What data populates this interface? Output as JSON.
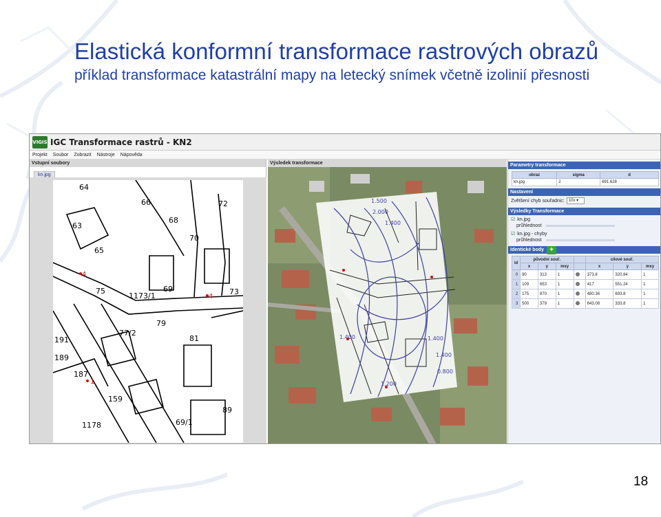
{
  "slide": {
    "title": "Elastická konformní transformace rastrových obrazů",
    "subtitle": "příklad transformace katastrální mapy na letecký snímek včetně izolinií přesnosti",
    "page_number": "18",
    "title_color": "#1f3fa8"
  },
  "app": {
    "logo": "VIGIS",
    "title": "IGC Transformace rastrů - KN2",
    "menu": [
      "Projekt",
      "Soubor",
      "Zobrazit",
      "Nástroje",
      "Nápověda"
    ]
  },
  "left_panel": {
    "header": "Vstupní soubory",
    "file_tab": "kn.jpg",
    "map_labels": [
      "64",
      "66",
      "68",
      "63",
      "70",
      "72",
      "65",
      "69",
      "1173/1",
      "73",
      "75",
      "77/2",
      "79",
      "191",
      "189",
      "81",
      "187",
      "159",
      "89",
      "1178",
      "69/1",
      "4",
      "4",
      "1",
      "1",
      "1",
      "1",
      "2",
      "3"
    ]
  },
  "mid_panel": {
    "header": "Výsledek transformace",
    "isoline_labels": [
      "1.500",
      "2.000",
      "1.400",
      "1.400",
      "1.400",
      "1.400",
      "1.200",
      "0.800"
    ]
  },
  "right_panel": {
    "params_header": "Parametry transformace",
    "params_columns": [
      "obraz",
      "sigma",
      "d"
    ],
    "params_row": [
      "kn.jpg",
      "2",
      "691.628"
    ],
    "settings_header": "Nastavení",
    "zoom_label": "Zvětšení chyb souřadnic:",
    "zoom_value": "10x",
    "results_header": "Výsledky Transformace",
    "results_items": [
      {
        "label": "kn.jpg",
        "sub": "průhlednost"
      },
      {
        "label": "kn.jpg - chyby",
        "sub": "průhlednost"
      }
    ],
    "identical_header": "Identické body",
    "identical_group_source": "původní souř.",
    "identical_group_target": "cílové souř.",
    "identical_columns": [
      "id",
      "x",
      "y",
      "mxy",
      "x",
      "y",
      "mxy"
    ],
    "identical_rows": [
      [
        "0",
        "90",
        "313",
        "1",
        "373.8",
        "320.84",
        "1"
      ],
      [
        "1",
        "109",
        "653",
        "1",
        "417",
        "551.24",
        "1"
      ],
      [
        "2",
        "175",
        "870",
        "1",
        "480.36",
        "693.8",
        "1"
      ],
      [
        "3",
        "500",
        "379",
        "1",
        "643.08",
        "333.8",
        "1"
      ]
    ]
  }
}
